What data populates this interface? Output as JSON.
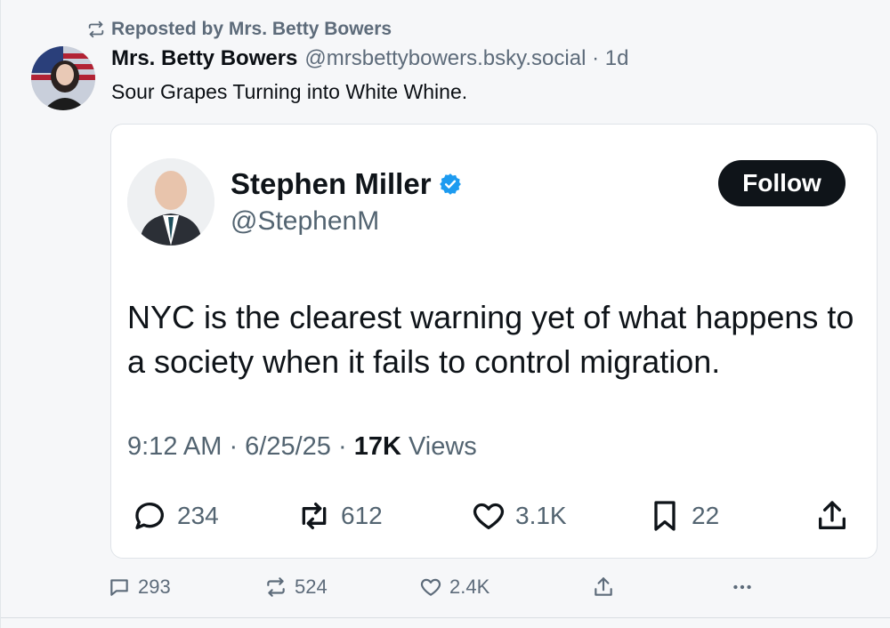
{
  "repost": {
    "text": "Reposted by Mrs. Betty Bowers"
  },
  "post": {
    "author_name": "Mrs. Betty Bowers",
    "author_handle": "@mrsbettybowers.bsky.social · 1d",
    "text": "Sour Grapes Turning into White Whine."
  },
  "embed": {
    "name": "Stephen Miller",
    "handle": "@StephenM",
    "follow_label": "Follow",
    "text": "NYC is the clearest warning yet of what happens to a society when it fails to control migration.",
    "time": "9:12 AM · 6/25/25 · ",
    "views_count": "17K",
    "views_label": " Views",
    "actions": {
      "replies": "234",
      "reposts": "612",
      "likes": "3.1K",
      "bookmarks": "22"
    }
  },
  "footer_actions": {
    "replies": "293",
    "reposts": "524",
    "likes": "2.4K"
  },
  "icons": {
    "repost": "repost-icon",
    "verified": "verified-badge-icon",
    "reply": "reply-icon",
    "like": "heart-icon",
    "bookmark": "bookmark-icon",
    "share": "share-icon",
    "more": "more-icon"
  },
  "colors": {
    "verified": "#1d9bf0",
    "muted": "#5d6b7a",
    "follow_bg": "#0f1419"
  }
}
